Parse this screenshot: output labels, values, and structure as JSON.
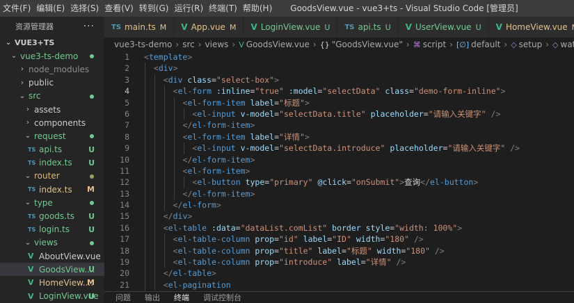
{
  "menubar": {
    "items": [
      "文件(F)",
      "编辑(E)",
      "选择(S)",
      "查看(V)",
      "转到(G)",
      "运行(R)",
      "终端(T)",
      "帮助(H)"
    ],
    "window_title": "GoodsView.vue - vue3+ts - Visual Studio Code [管理员]"
  },
  "sidebar": {
    "title": "资源管理器",
    "more": "···",
    "rows": [
      {
        "label": "VUE3+TS",
        "twisty": "⌄",
        "indent": 6,
        "kind": "section",
        "color": ""
      },
      {
        "label": "vue3-ts-demo",
        "twisty": "⌄",
        "indent": 14,
        "kind": "folder",
        "color": "lbl-green",
        "dot": "green"
      },
      {
        "label": "node_modules",
        "twisty": "›",
        "indent": 26,
        "kind": "folder",
        "color": "lbl-dim"
      },
      {
        "label": "public",
        "twisty": "›",
        "indent": 26,
        "kind": "folder",
        "color": ""
      },
      {
        "label": "src",
        "twisty": "⌄",
        "indent": 26,
        "kind": "folder",
        "color": "lbl-green",
        "dot": "green"
      },
      {
        "label": "assets",
        "twisty": "›",
        "indent": 34,
        "kind": "folder",
        "color": ""
      },
      {
        "label": "components",
        "twisty": "›",
        "indent": 34,
        "kind": "folder",
        "color": ""
      },
      {
        "label": "request",
        "twisty": "⌄",
        "indent": 34,
        "kind": "folder",
        "color": "lbl-green",
        "dot": "green"
      },
      {
        "label": "api.ts",
        "icon": "TS",
        "iconkind": "ts",
        "indent": 38,
        "kind": "file",
        "color": "lbl-green",
        "badge": "U"
      },
      {
        "label": "index.ts",
        "icon": "TS",
        "iconkind": "ts",
        "indent": 38,
        "kind": "file",
        "color": "lbl-green",
        "badge": "U"
      },
      {
        "label": "router",
        "twisty": "⌄",
        "indent": 34,
        "kind": "folder",
        "color": "lbl-orange",
        "dot": "orange"
      },
      {
        "label": "index.ts",
        "icon": "TS",
        "iconkind": "ts",
        "indent": 38,
        "kind": "file",
        "color": "lbl-yellow",
        "badge": "M"
      },
      {
        "label": "type",
        "twisty": "⌄",
        "indent": 34,
        "kind": "folder",
        "color": "lbl-green",
        "dot": "green"
      },
      {
        "label": "goods.ts",
        "icon": "TS",
        "iconkind": "ts",
        "indent": 38,
        "kind": "file",
        "color": "lbl-green",
        "badge": "U"
      },
      {
        "label": "login.ts",
        "icon": "TS",
        "iconkind": "ts",
        "indent": 38,
        "kind": "file",
        "color": "lbl-green",
        "badge": "U"
      },
      {
        "label": "views",
        "twisty": "⌄",
        "indent": 34,
        "kind": "folder",
        "color": "lbl-green",
        "dot": "green"
      },
      {
        "label": "AboutView.vue",
        "icon": "V",
        "iconkind": "vue",
        "indent": 38,
        "kind": "file",
        "color": ""
      },
      {
        "label": "GoodsView....",
        "icon": "V",
        "iconkind": "vue",
        "indent": 38,
        "kind": "file",
        "color": "lbl-green",
        "badge": "U",
        "active": true
      },
      {
        "label": "HomeView....",
        "icon": "V",
        "iconkind": "vue",
        "indent": 38,
        "kind": "file",
        "color": "lbl-yellow",
        "badge": "M"
      },
      {
        "label": "LoginView.vue",
        "icon": "V",
        "iconkind": "vue",
        "indent": 38,
        "kind": "file",
        "color": "lbl-green",
        "badge": "U"
      }
    ]
  },
  "tabs": [
    {
      "name": "main.ts",
      "icon": "TS",
      "iconkind": "ts",
      "status": "M",
      "statuskind": "m",
      "mod": true
    },
    {
      "name": "App.vue",
      "icon": "V",
      "iconkind": "vue",
      "status": "M",
      "statuskind": "m",
      "mod": true
    },
    {
      "name": "LoginView.vue",
      "icon": "V",
      "iconkind": "vue",
      "status": "U",
      "statuskind": "u",
      "mod": false
    },
    {
      "name": "api.ts",
      "icon": "TS",
      "iconkind": "ts",
      "status": "U",
      "statuskind": "u",
      "mod": false
    },
    {
      "name": "UserView.vue",
      "icon": "V",
      "iconkind": "vue",
      "status": "U",
      "statuskind": "u",
      "mod": false
    },
    {
      "name": "HomeView.vue",
      "icon": "V",
      "iconkind": "vue",
      "status": "M",
      "statuskind": "m",
      "mod": true
    }
  ],
  "breadcrumbs": [
    {
      "text": "vue3-ts-demo"
    },
    {
      "text": "src"
    },
    {
      "text": "views"
    },
    {
      "text": "GoodsView.vue",
      "icon": "V",
      "iconcolor": "#41b883"
    },
    {
      "text": "\"GoodsView.vue\"",
      "icon": "{}",
      "iconcolor": "#d4d4d4"
    },
    {
      "text": "script",
      "icon": "⌘",
      "iconcolor": "#b180d7"
    },
    {
      "text": "default",
      "icon": "[∅]",
      "iconcolor": "#75beff"
    },
    {
      "text": "setup",
      "icon": "◇",
      "iconcolor": "#b180d7"
    },
    {
      "text": "watch() callback",
      "icon": "◇",
      "iconcolor": "#b180d7"
    }
  ],
  "editor": {
    "lines": [
      {
        "n": "1",
        "indent": 0,
        "parts": [
          [
            "br",
            "<"
          ],
          [
            "tag",
            "template"
          ],
          [
            "br",
            ">"
          ]
        ]
      },
      {
        "n": "2",
        "indent": 1,
        "parts": [
          [
            "br",
            "<"
          ],
          [
            "tag",
            "div"
          ],
          [
            "br",
            ">"
          ]
        ]
      },
      {
        "n": "3",
        "indent": 2,
        "parts": [
          [
            "br",
            "<"
          ],
          [
            "tag",
            "div"
          ],
          [
            "txt",
            " "
          ],
          [
            "attr",
            "class"
          ],
          [
            "txt",
            "="
          ],
          [
            "str",
            "\"select-box\""
          ],
          [
            "br",
            ">"
          ]
        ]
      },
      {
        "n": "4",
        "indent": 3,
        "parts": [
          [
            "br",
            "<"
          ],
          [
            "tag",
            "el-form"
          ],
          [
            "txt",
            " "
          ],
          [
            "attr",
            ":inline"
          ],
          [
            "txt",
            "="
          ],
          [
            "str",
            "\"true\""
          ],
          [
            "txt",
            " "
          ],
          [
            "attr",
            ":model"
          ],
          [
            "txt",
            "="
          ],
          [
            "str",
            "\"selectData\""
          ],
          [
            "txt",
            " "
          ],
          [
            "attr",
            "class"
          ],
          [
            "txt",
            "="
          ],
          [
            "str",
            "\"demo-form-inline\""
          ],
          [
            "br",
            ">"
          ]
        ]
      },
      {
        "n": "5",
        "indent": 4,
        "parts": [
          [
            "br",
            "<"
          ],
          [
            "tag",
            "el-form-item"
          ],
          [
            "txt",
            " "
          ],
          [
            "attr",
            "label"
          ],
          [
            "txt",
            "="
          ],
          [
            "str",
            "\"标题\""
          ],
          [
            "br",
            ">"
          ]
        ]
      },
      {
        "n": "6",
        "indent": 5,
        "parts": [
          [
            "br",
            "<"
          ],
          [
            "tag",
            "el-input"
          ],
          [
            "txt",
            " "
          ],
          [
            "attr",
            "v-model"
          ],
          [
            "txt",
            "="
          ],
          [
            "str",
            "\"selectData.title\""
          ],
          [
            "txt",
            " "
          ],
          [
            "attr",
            "placeholder"
          ],
          [
            "txt",
            "="
          ],
          [
            "str",
            "\"请输入关键字\""
          ],
          [
            "txt",
            " "
          ],
          [
            "br",
            "/>"
          ]
        ]
      },
      {
        "n": "7",
        "indent": 4,
        "parts": [
          [
            "br",
            "</"
          ],
          [
            "tag",
            "el-form-item"
          ],
          [
            "br",
            ">"
          ]
        ]
      },
      {
        "n": "8",
        "indent": 4,
        "parts": [
          [
            "br",
            "<"
          ],
          [
            "tag",
            "el-form-item"
          ],
          [
            "txt",
            " "
          ],
          [
            "attr",
            "label"
          ],
          [
            "txt",
            "="
          ],
          [
            "str",
            "\"详情\""
          ],
          [
            "br",
            ">"
          ]
        ]
      },
      {
        "n": "9",
        "indent": 5,
        "parts": [
          [
            "br",
            "<"
          ],
          [
            "tag",
            "el-input"
          ],
          [
            "txt",
            " "
          ],
          [
            "attr",
            "v-model"
          ],
          [
            "txt",
            "="
          ],
          [
            "str",
            "\"selectData.introduce\""
          ],
          [
            "txt",
            " "
          ],
          [
            "attr",
            "placeholder"
          ],
          [
            "txt",
            "="
          ],
          [
            "str",
            "\"请输入关键字\""
          ],
          [
            "txt",
            " "
          ],
          [
            "br",
            "/>"
          ]
        ]
      },
      {
        "n": "10",
        "indent": 4,
        "parts": [
          [
            "br",
            "</"
          ],
          [
            "tag",
            "el-form-item"
          ],
          [
            "br",
            ">"
          ]
        ]
      },
      {
        "n": "11",
        "indent": 4,
        "parts": [
          [
            "br",
            "<"
          ],
          [
            "tag",
            "el-form-item"
          ],
          [
            "br",
            ">"
          ]
        ]
      },
      {
        "n": "12",
        "indent": 5,
        "parts": [
          [
            "br",
            "<"
          ],
          [
            "tag",
            "el-button"
          ],
          [
            "txt",
            " "
          ],
          [
            "attr",
            "type"
          ],
          [
            "txt",
            "="
          ],
          [
            "str",
            "\"primary\""
          ],
          [
            "txt",
            " "
          ],
          [
            "attr",
            "@click"
          ],
          [
            "txt",
            "="
          ],
          [
            "str",
            "\"onSubmit\""
          ],
          [
            "br",
            ">"
          ],
          [
            "txt",
            "查询"
          ],
          [
            "br",
            "</"
          ],
          [
            "tag",
            "el-button"
          ],
          [
            "br",
            ">"
          ]
        ]
      },
      {
        "n": "13",
        "indent": 4,
        "parts": [
          [
            "br",
            "</"
          ],
          [
            "tag",
            "el-form-item"
          ],
          [
            "br",
            ">"
          ]
        ]
      },
      {
        "n": "14",
        "indent": 3,
        "parts": [
          [
            "br",
            "</"
          ],
          [
            "tag",
            "el-form"
          ],
          [
            "br",
            ">"
          ]
        ]
      },
      {
        "n": "15",
        "indent": 2,
        "parts": [
          [
            "br",
            "</"
          ],
          [
            "tag",
            "div"
          ],
          [
            "br",
            ">"
          ]
        ]
      },
      {
        "n": "16",
        "indent": 2,
        "parts": [
          [
            "br",
            "<"
          ],
          [
            "tag",
            "el-table"
          ],
          [
            "txt",
            " "
          ],
          [
            "attr",
            ":data"
          ],
          [
            "txt",
            "="
          ],
          [
            "str",
            "\"dataList.comList\""
          ],
          [
            "txt",
            " "
          ],
          [
            "attr",
            "border"
          ],
          [
            "txt",
            " "
          ],
          [
            "attr",
            "style"
          ],
          [
            "txt",
            "="
          ],
          [
            "str",
            "\"width: 100%\""
          ],
          [
            "br",
            ">"
          ]
        ]
      },
      {
        "n": "17",
        "indent": 3,
        "parts": [
          [
            "br",
            "<"
          ],
          [
            "tag",
            "el-table-column"
          ],
          [
            "txt",
            " "
          ],
          [
            "attr",
            "prop"
          ],
          [
            "txt",
            "="
          ],
          [
            "str",
            "\"id\""
          ],
          [
            "txt",
            " "
          ],
          [
            "attr",
            "label"
          ],
          [
            "txt",
            "="
          ],
          [
            "str",
            "\"ID\""
          ],
          [
            "txt",
            " "
          ],
          [
            "attr",
            "width"
          ],
          [
            "txt",
            "="
          ],
          [
            "str",
            "\"180\""
          ],
          [
            "txt",
            " "
          ],
          [
            "br",
            "/>"
          ]
        ]
      },
      {
        "n": "18",
        "indent": 3,
        "parts": [
          [
            "br",
            "<"
          ],
          [
            "tag",
            "el-table-column"
          ],
          [
            "txt",
            " "
          ],
          [
            "attr",
            "prop"
          ],
          [
            "txt",
            "="
          ],
          [
            "str",
            "\"title\""
          ],
          [
            "txt",
            " "
          ],
          [
            "attr",
            "label"
          ],
          [
            "txt",
            "="
          ],
          [
            "str",
            "\"标题\""
          ],
          [
            "txt",
            " "
          ],
          [
            "attr",
            "width"
          ],
          [
            "txt",
            "="
          ],
          [
            "str",
            "\"180\""
          ],
          [
            "txt",
            " "
          ],
          [
            "br",
            "/>"
          ]
        ]
      },
      {
        "n": "19",
        "indent": 3,
        "parts": [
          [
            "br",
            "<"
          ],
          [
            "tag",
            "el-table-column"
          ],
          [
            "txt",
            " "
          ],
          [
            "attr",
            "prop"
          ],
          [
            "txt",
            "="
          ],
          [
            "str",
            "\"introduce\""
          ],
          [
            "txt",
            " "
          ],
          [
            "attr",
            "label"
          ],
          [
            "txt",
            "="
          ],
          [
            "str",
            "\"详情\""
          ],
          [
            "txt",
            " "
          ],
          [
            "br",
            "/>"
          ]
        ]
      },
      {
        "n": "20",
        "indent": 2,
        "parts": [
          [
            "br",
            "</"
          ],
          [
            "tag",
            "el-table"
          ],
          [
            "br",
            ">"
          ]
        ]
      },
      {
        "n": "21",
        "indent": 2,
        "parts": [
          [
            "br",
            "<"
          ],
          [
            "tag",
            "el-pagination"
          ]
        ]
      }
    ]
  },
  "panel": {
    "tabs": [
      "问题",
      "输出",
      "终端",
      "调试控制台"
    ],
    "active_index": 2
  }
}
